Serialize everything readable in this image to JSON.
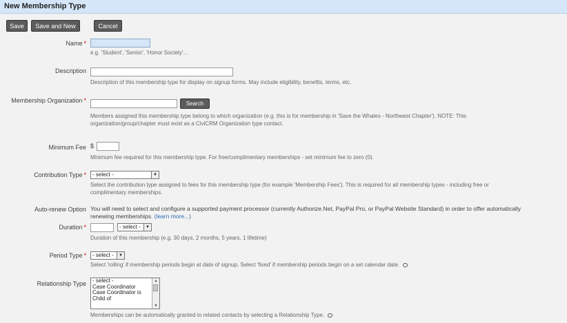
{
  "header": {
    "title": "New Membership Type"
  },
  "toolbar": {
    "save": "Save",
    "save_new": "Save and New",
    "cancel": "Cancel"
  },
  "required_marker": "*",
  "fields": {
    "name": {
      "label": "Name",
      "value": "",
      "help": "e.g. 'Student', 'Senior', 'Honor Society'..."
    },
    "description": {
      "label": "Description",
      "value": "",
      "help": "Description of this membership type for display on signup forms. May include eligibility, benefits, terms, etc."
    },
    "organization": {
      "label": "Membership Organization",
      "value": "",
      "button": "Search",
      "help_line1": "Members assigned this membership type belong to which organization (e.g. this is for membership in 'Save the Whales - Northwest Chapter'). NOTE: This",
      "help_line2": "organization/group/chapter must exist as a CiviCRM Organization type contact."
    },
    "minimum_fee": {
      "label": "Minimum Fee",
      "currency": "$",
      "value": "",
      "help": "Minimum fee required for this membership type. For free/complimentary memberships - set minimum fee to zero (0)."
    },
    "contribution_type": {
      "label": "Contribution Type",
      "selected": "- select -",
      "help_line1": "Select the contribution type assigned to fees for this membership type (for example 'Membership Fees'). This is required for all membership types - including free or",
      "help_line2": "complimentary memberships."
    },
    "auto_renew": {
      "label": "Auto-renew Option",
      "text_line1": "You will need to select and configure a supported payment processor (currently Authorize.Net, PayPal Pro, or PayPal Website Standard) in order to offer automatically",
      "text_line2": "renewing memberships.",
      "link": "(learn more...)"
    },
    "duration": {
      "label": "Duration",
      "value": "",
      "unit_selected": "- select -",
      "help": "Duration of this membership (e.g. 30 days, 2 months, 5 years, 1 lifetime)"
    },
    "period_type": {
      "label": "Period Type",
      "selected": "- select -",
      "help": "Select 'rolling' if membership periods begin at date of signup. Select 'fixed' if membership periods begin on a set calendar date."
    },
    "relationship_type": {
      "label": "Relationship Type",
      "options": [
        "- select -",
        "Case Coordinator",
        "Case Coordinator is",
        "Child of"
      ],
      "help": "Memberships can be automatically granted to related contacts by selecting a Relationship Type."
    }
  }
}
